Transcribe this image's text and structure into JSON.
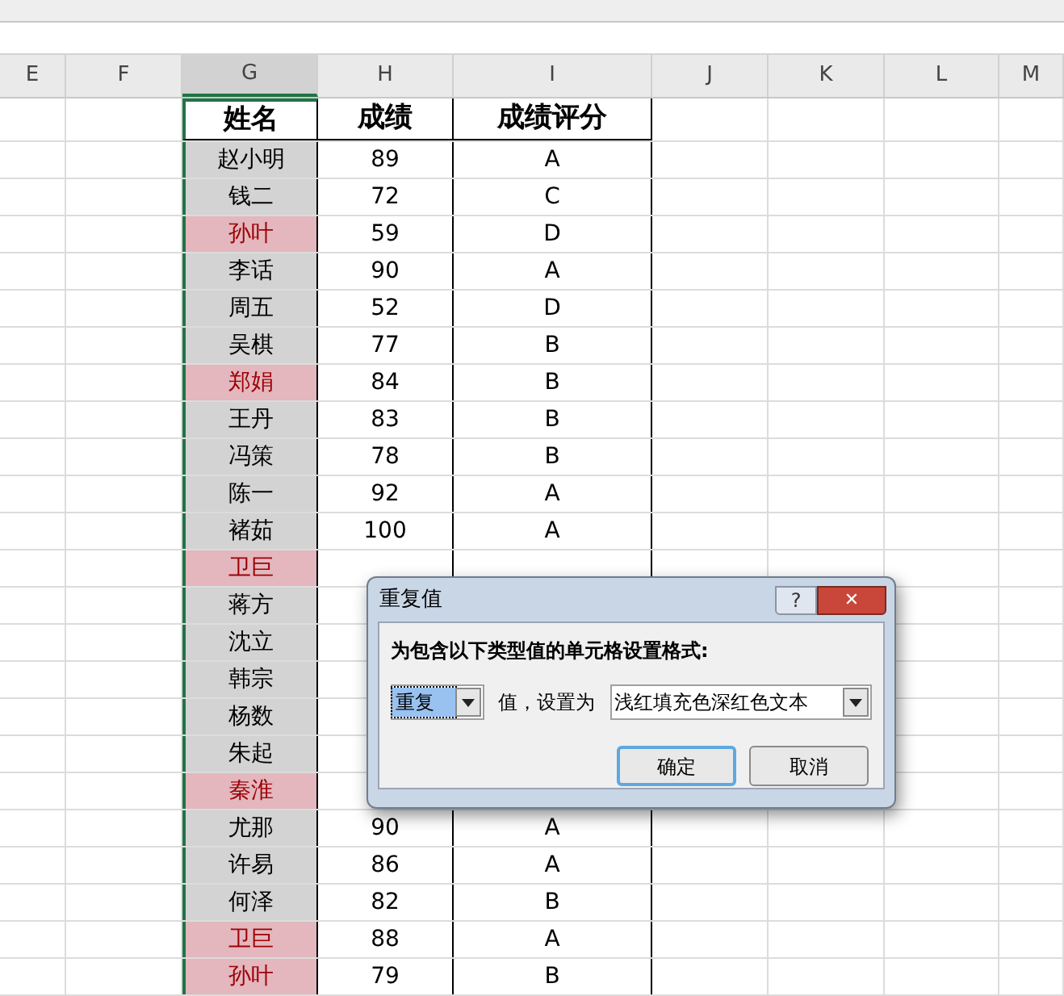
{
  "columns": [
    {
      "label": "E",
      "selected": false
    },
    {
      "label": "F",
      "selected": false
    },
    {
      "label": "G",
      "selected": true
    },
    {
      "label": "H",
      "selected": false
    },
    {
      "label": "I",
      "selected": false
    },
    {
      "label": "J",
      "selected": false
    },
    {
      "label": "K",
      "selected": false
    },
    {
      "label": "L",
      "selected": false
    },
    {
      "label": "M",
      "selected": false
    }
  ],
  "table": {
    "headers": [
      "姓名",
      "成绩",
      "成绩评分"
    ],
    "rows": [
      {
        "name": "赵小明",
        "score": "89",
        "grade": "A",
        "duplicate": false
      },
      {
        "name": "钱二",
        "score": "72",
        "grade": "C",
        "duplicate": false
      },
      {
        "name": "孙叶",
        "score": "59",
        "grade": "D",
        "duplicate": true
      },
      {
        "name": "李话",
        "score": "90",
        "grade": "A",
        "duplicate": false
      },
      {
        "name": "周五",
        "score": "52",
        "grade": "D",
        "duplicate": false
      },
      {
        "name": "吴棋",
        "score": "77",
        "grade": "B",
        "duplicate": false
      },
      {
        "name": "郑娟",
        "score": "84",
        "grade": "B",
        "duplicate": true
      },
      {
        "name": "王丹",
        "score": "83",
        "grade": "B",
        "duplicate": false
      },
      {
        "name": "冯策",
        "score": "78",
        "grade": "B",
        "duplicate": false
      },
      {
        "name": "陈一",
        "score": "92",
        "grade": "A",
        "duplicate": false
      },
      {
        "name": "褚茹",
        "score": "100",
        "grade": "A",
        "duplicate": false
      },
      {
        "name": "卫巨",
        "duplicate": true
      },
      {
        "name": "蒋方",
        "duplicate": false
      },
      {
        "name": "沈立",
        "duplicate": false
      },
      {
        "name": "韩宗",
        "duplicate": false
      },
      {
        "name": "杨数",
        "duplicate": false
      },
      {
        "name": "朱起",
        "duplicate": false
      },
      {
        "name": "秦淮",
        "duplicate": true
      },
      {
        "name": "尤那",
        "score": "90",
        "grade": "A",
        "duplicate": false
      },
      {
        "name": "许易",
        "score": "86",
        "grade": "A",
        "duplicate": false
      },
      {
        "name": "何泽",
        "score": "82",
        "grade": "B",
        "duplicate": false
      },
      {
        "name": "卫巨",
        "score": "88",
        "grade": "A",
        "duplicate": true
      },
      {
        "name": "孙叶",
        "score": "79",
        "grade": "B",
        "duplicate": true
      }
    ]
  },
  "dialog": {
    "title": "重复值",
    "help": "?",
    "close": "✕",
    "prompt": "为包含以下类型值的单元格设置格式:",
    "type_value": "重复",
    "label": "值，设置为",
    "format_value": "浅红填充色深红色文本",
    "buttons": [
      "确定",
      "取消"
    ]
  }
}
